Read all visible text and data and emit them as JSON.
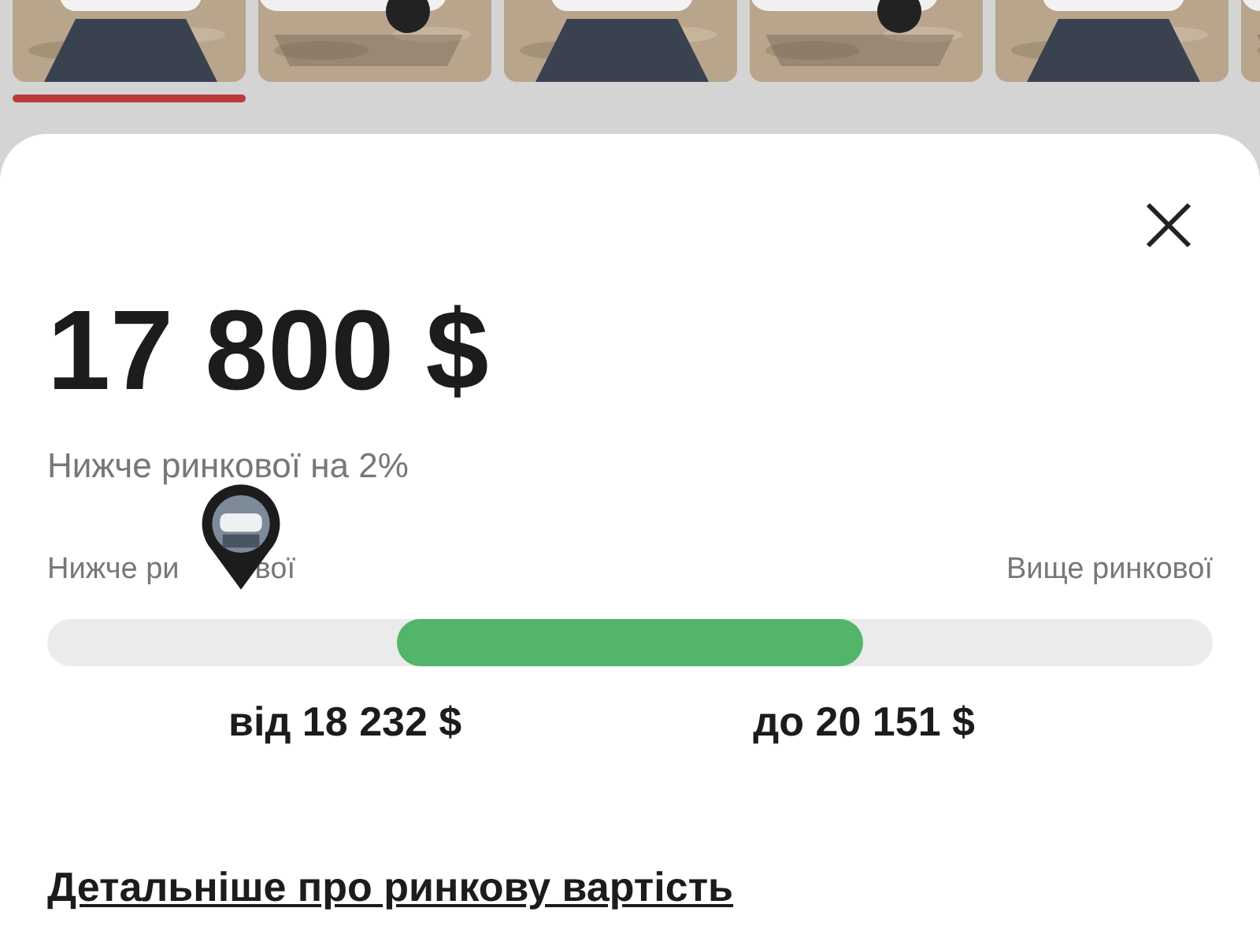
{
  "gallery": {
    "thumbnails": [
      {
        "kind": "picture",
        "selected": true
      },
      {
        "kind": "picture",
        "selected": false
      },
      {
        "kind": "picture",
        "selected": false
      },
      {
        "kind": "picture",
        "selected": false
      },
      {
        "kind": "picture",
        "selected": false
      },
      {
        "kind": "picture",
        "selected": false
      }
    ]
  },
  "sheet": {
    "price": "17 800 $",
    "comparison": "Нижче ринкової на 2%",
    "scale": {
      "low_label": "Нижче ри",
      "low_label_tail": "вої",
      "high_label": "Вище ринкової",
      "range_from": "від 18 232 $",
      "range_to": "до 20 151 $"
    },
    "details_link": "Детальніше про ринкову вартість"
  }
}
